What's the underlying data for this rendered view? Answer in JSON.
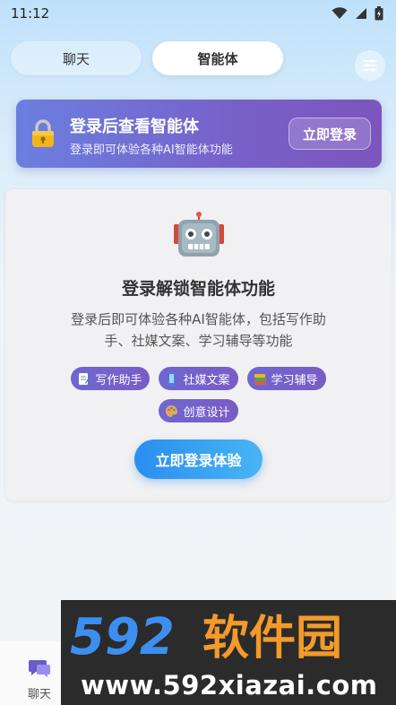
{
  "status_bar": {
    "time": "11:12"
  },
  "tabs": [
    {
      "label": "聊天",
      "active": false
    },
    {
      "label": "智能体",
      "active": true
    }
  ],
  "banner": {
    "title": "登录后查看智能体",
    "subtitle": "登录即可体验各种AI智能体功能",
    "button_label": "立即登录"
  },
  "unlock_card": {
    "title": "登录解锁智能体功能",
    "description": "登录后即可体验各种AI智能体，包括写作助手、社媒文案、学习辅导等功能",
    "tags": [
      {
        "label": "写作助手",
        "icon": "memo-icon"
      },
      {
        "label": "社媒文案",
        "icon": "phone-icon"
      },
      {
        "label": "学习辅导",
        "icon": "books-icon"
      },
      {
        "label": "创意设计",
        "icon": "palette-icon"
      }
    ],
    "button_label": "立即登录体验"
  },
  "bottom_nav": {
    "chat_label": "聊天"
  },
  "watermark": {
    "logo_text": "592软件园",
    "url": "www.592xiazai.com"
  },
  "colors": {
    "banner_gradient": [
      "#6b7fe0",
      "#7c55bd"
    ],
    "tag_color": "#7264ce",
    "primary_button": "#2b8df0",
    "watermark_blue": "#3c8ff0",
    "watermark_orange": "#f39a2a"
  }
}
